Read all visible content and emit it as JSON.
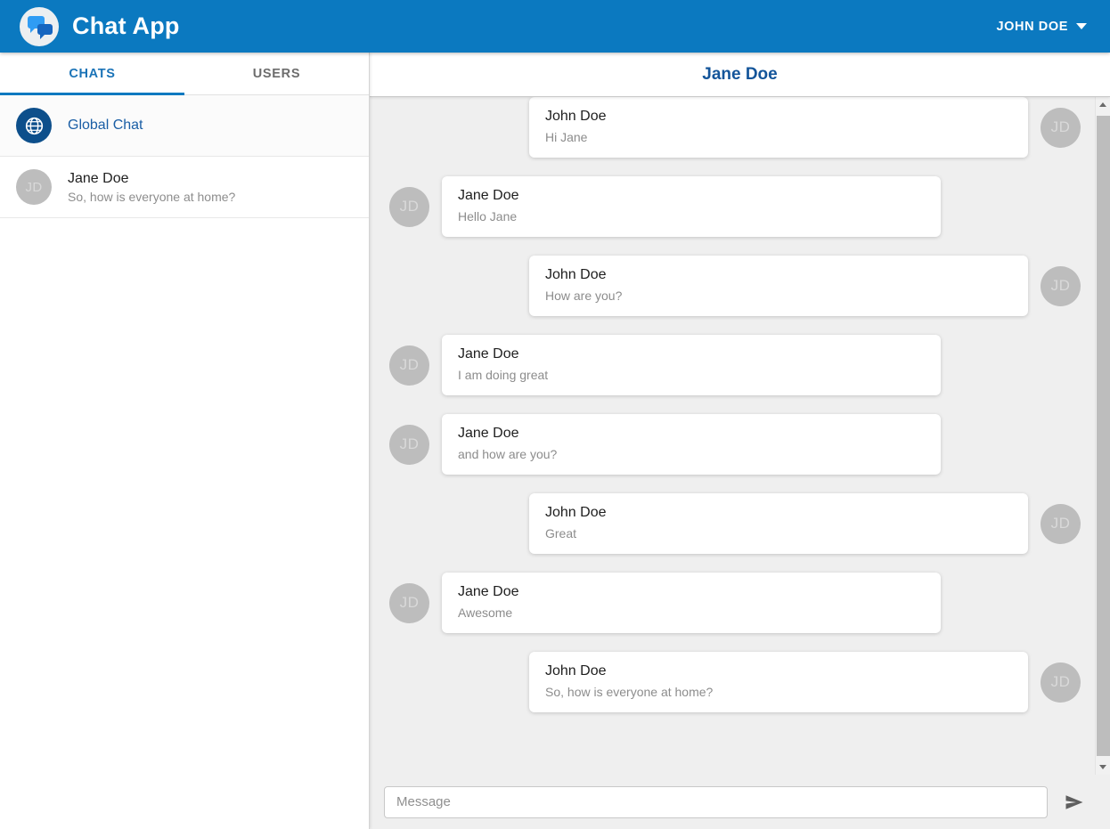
{
  "app": {
    "title": "Chat App",
    "logo_icon": "chat-bubbles-logo-icon",
    "accent_color": "#0b79c0",
    "user_menu_label": "JOHN DOE",
    "caret_icon": "chevron-down-icon"
  },
  "sidebar": {
    "tabs": [
      {
        "label": "CHATS",
        "active": true
      },
      {
        "label": "USERS",
        "active": false
      }
    ],
    "items": [
      {
        "name": "Global Chat",
        "subtitle": "",
        "avatar_icon": "globe-icon",
        "avatar_initials": "",
        "selected": true
      },
      {
        "name": "Jane Doe",
        "subtitle": "So, how is everyone at home?",
        "avatar_icon": "",
        "avatar_initials": "JD",
        "selected": false
      }
    ]
  },
  "chat": {
    "header_title": "Jane Doe",
    "messages": [
      {
        "sender": "John Doe",
        "text": "Hi Jane",
        "initials": "JD",
        "side": "out"
      },
      {
        "sender": "Jane Doe",
        "text": "Hello Jane",
        "initials": "JD",
        "side": "in"
      },
      {
        "sender": "John Doe",
        "text": "How are you?",
        "initials": "JD",
        "side": "out"
      },
      {
        "sender": "Jane Doe",
        "text": "I am doing great",
        "initials": "JD",
        "side": "in"
      },
      {
        "sender": "Jane Doe",
        "text": "and how are you?",
        "initials": "JD",
        "side": "in"
      },
      {
        "sender": "John Doe",
        "text": "Great",
        "initials": "JD",
        "side": "out"
      },
      {
        "sender": "Jane Doe",
        "text": "Awesome",
        "initials": "JD",
        "side": "in"
      },
      {
        "sender": "John Doe",
        "text": "So, how is everyone at home?",
        "initials": "JD",
        "side": "out"
      }
    ]
  },
  "composer": {
    "placeholder": "Message",
    "value": "",
    "send_icon": "send-icon"
  },
  "scrollbar": {
    "up_icon": "scroll-up-arrow-icon",
    "down_icon": "scroll-down-arrow-icon"
  }
}
